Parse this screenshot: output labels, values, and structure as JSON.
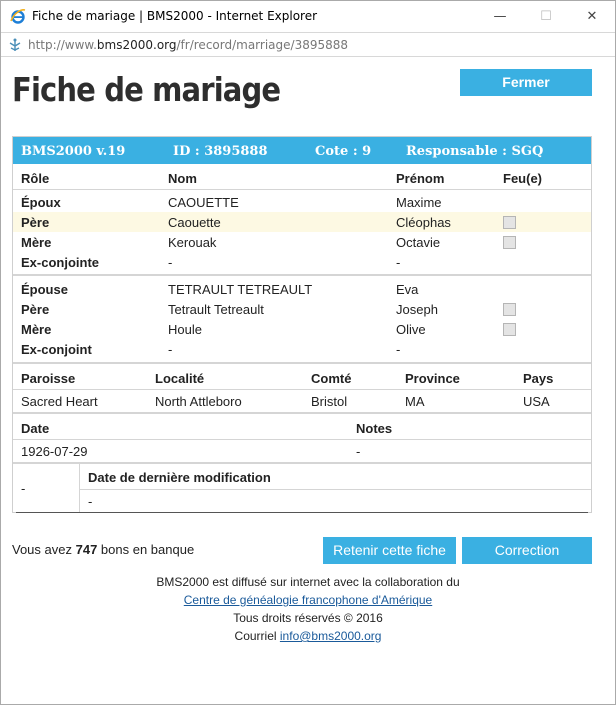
{
  "window": {
    "title": "Fiche de mariage | BMS2000 - Internet Explorer",
    "minimize_label": "—",
    "maximize_label": "☐",
    "close_label": "✕"
  },
  "address": {
    "prefix": "http://www.",
    "domain": "bms2000.org",
    "path": "/fr/record/marriage/3895888"
  },
  "page": {
    "title": "Fiche de mariage",
    "close_button": "Fermer"
  },
  "record": {
    "header": {
      "version": "BMS2000 v.19",
      "id": "ID : 3895888",
      "cote": "Cote : 9",
      "responsable": "Responsable : SGQ"
    },
    "columns": {
      "role": "Rôle",
      "nom": "Nom",
      "prenom": "Prénom",
      "feu": "Feu(e)"
    },
    "groom": [
      {
        "role": "Époux",
        "nom": "CAOUETTE",
        "prenom": "Maxime",
        "checkbox": false
      },
      {
        "role": "Père",
        "nom": "Caouette",
        "prenom": "Cléophas",
        "checkbox": true
      },
      {
        "role": "Mère",
        "nom": "Kerouak",
        "prenom": "Octavie",
        "checkbox": true
      },
      {
        "role": "Ex-conjointe",
        "nom": "-",
        "prenom": "-",
        "checkbox": false
      }
    ],
    "bride": [
      {
        "role": "Épouse",
        "nom": "TETRAULT TETREAULT",
        "prenom": "Eva",
        "checkbox": false
      },
      {
        "role": "Père",
        "nom": "Tetrault Tetreault",
        "prenom": "Joseph",
        "checkbox": true
      },
      {
        "role": "Mère",
        "nom": "Houle",
        "prenom": "Olive",
        "checkbox": true
      },
      {
        "role": "Ex-conjoint",
        "nom": "-",
        "prenom": "-",
        "checkbox": false
      }
    ],
    "place": {
      "headers": {
        "paroisse": "Paroisse",
        "localite": "Localité",
        "comte": "Comté",
        "province": "Province",
        "pays": "Pays"
      },
      "values": {
        "paroisse": "Sacred Heart",
        "localite": "North Attleboro",
        "comte": "Bristol",
        "province": "MA",
        "pays": "USA"
      }
    },
    "date": {
      "headers": {
        "date": "Date",
        "notes": "Notes"
      },
      "values": {
        "date": "1926-07-29",
        "notes": "-"
      }
    },
    "modification": {
      "left_value": "-",
      "header": "Date de dernière modification",
      "value": "-"
    }
  },
  "bank": {
    "prefix": "Vous avez ",
    "count": "747",
    "suffix": " bons en banque"
  },
  "actions": {
    "keep": "Retenir cette fiche",
    "correction": "Correction"
  },
  "footer": {
    "line1": "BMS2000 est diffusé sur internet avec la collaboration du",
    "link": "Centre de généalogie francophone d'Amérique",
    "rights": "Tous droits réservés © 2016",
    "mail_prefix": "Courriel ",
    "mail": "info@bms2000.org"
  },
  "colors": {
    "accent": "#3ab0e2",
    "highlight": "#fdf9e3",
    "link": "#1a5a9a"
  }
}
